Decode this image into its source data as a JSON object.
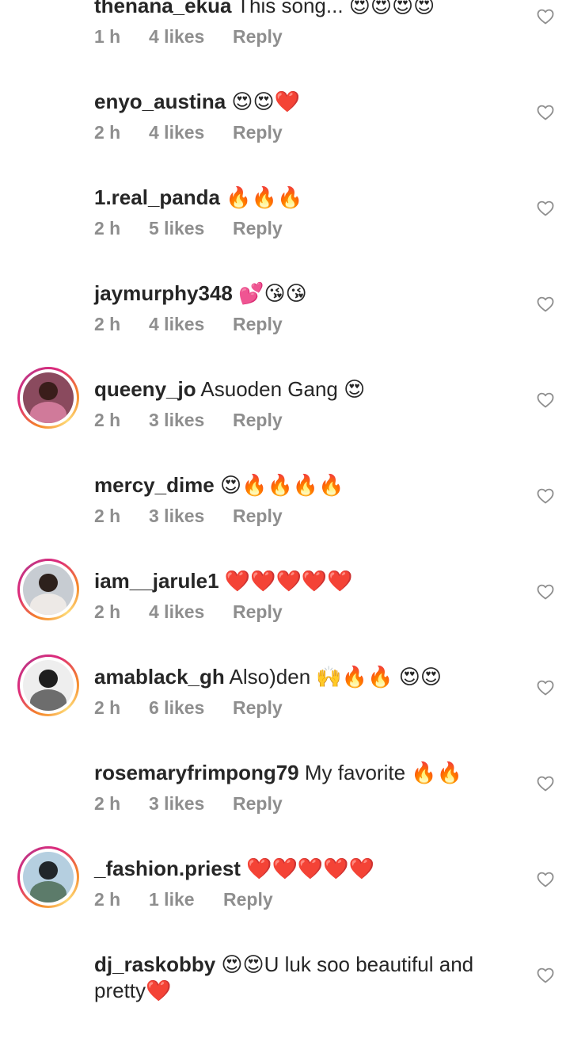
{
  "comments": [
    {
      "username": "thenana_ekua",
      "text": "This song...",
      "emoji": "😍😍😍😍",
      "time": "1 h",
      "likes": "4 likes",
      "reply": "Reply",
      "story": false,
      "avatar": {
        "bg": "#c9cfc5",
        "head": "#3a2a22",
        "body": "#e8e2dc"
      }
    },
    {
      "username": "enyo_austina",
      "text": "",
      "emoji": "😍😍❤️",
      "time": "2 h",
      "likes": "4 likes",
      "reply": "Reply",
      "story": false,
      "avatar": {
        "bg": "#5d4a36",
        "head": "#2b1d14",
        "body": "#3a3b2e"
      }
    },
    {
      "username": "1.real_panda",
      "text": "",
      "emoji": "🔥🔥🔥",
      "time": "2 h",
      "likes": "5 likes",
      "reply": "Reply",
      "story": false,
      "avatar": {
        "bg": "#e4e4e4",
        "head": "#1a1a1a",
        "body": "#3a3a3a"
      }
    },
    {
      "username": "jaymurphy348",
      "text": "",
      "emoji": "💕😘😘",
      "time": "2 h",
      "likes": "4 likes",
      "reply": "Reply",
      "story": false,
      "avatar": {
        "bg": "#6f5a58",
        "head": "#2c201d",
        "body": "#3c5678"
      }
    },
    {
      "username": "queeny_jo",
      "text": "Asuoden Gang",
      "emoji": "😍",
      "time": "2 h",
      "likes": "3 likes",
      "reply": "Reply",
      "story": true,
      "avatar": {
        "bg": "#8a4a5e",
        "head": "#3a1d1a",
        "body": "#d07a9a"
      }
    },
    {
      "username": "mercy_dime",
      "text": "",
      "emoji": "😍🔥🔥🔥🔥",
      "time": "2 h",
      "likes": "3 likes",
      "reply": "Reply",
      "story": false,
      "avatar": {
        "bg": "#c9a7d6",
        "head": "#2e1d2a",
        "body": "#4e2a4a"
      }
    },
    {
      "username": "iam__jarule1",
      "text": "",
      "emoji": "❤️❤️❤️❤️❤️",
      "time": "2 h",
      "likes": "4 likes",
      "reply": "Reply",
      "story": true,
      "avatar": {
        "bg": "#c7ccd2",
        "head": "#2d211c",
        "body": "#ede9e6"
      }
    },
    {
      "username": "amablack_gh",
      "text": "Also)den",
      "emoji": "🙌🔥🔥 😍😍",
      "time": "2 h",
      "likes": "6 likes",
      "reply": "Reply",
      "story": true,
      "avatar": {
        "bg": "#eeeeee",
        "head": "#1e1e1e",
        "body": "#6d6d6d"
      }
    },
    {
      "username": "rosemaryfrimpong79",
      "text": "My favorite",
      "emoji": "🔥🔥",
      "time": "2 h",
      "likes": "3 likes",
      "reply": "Reply",
      "story": false,
      "avatar": {
        "bg": "#7d2a22",
        "head": "#2b1411",
        "body": "#e04a2e"
      }
    },
    {
      "username": "_fashion.priest",
      "text": "",
      "emoji": "❤️❤️❤️❤️❤️",
      "time": "2 h",
      "likes": "1 like",
      "reply": "Reply",
      "story": true,
      "avatar": {
        "bg": "#b5cfe0",
        "head": "#20262a",
        "body": "#5c7b6a"
      }
    },
    {
      "username": "dj_raskobby",
      "text": "U luk soo beautiful and pretty",
      "emoji_before": "😍😍",
      "emoji": "❤️",
      "time": "",
      "likes": "",
      "reply": "",
      "story": false,
      "avatar": {
        "bg": "#6a5a4a",
        "head": "#1f1410",
        "body": "#2d2a2a"
      }
    }
  ],
  "colors": {
    "meta": "#8e8e8e",
    "text": "#262626",
    "heart_stroke": "#8e8e8e"
  }
}
